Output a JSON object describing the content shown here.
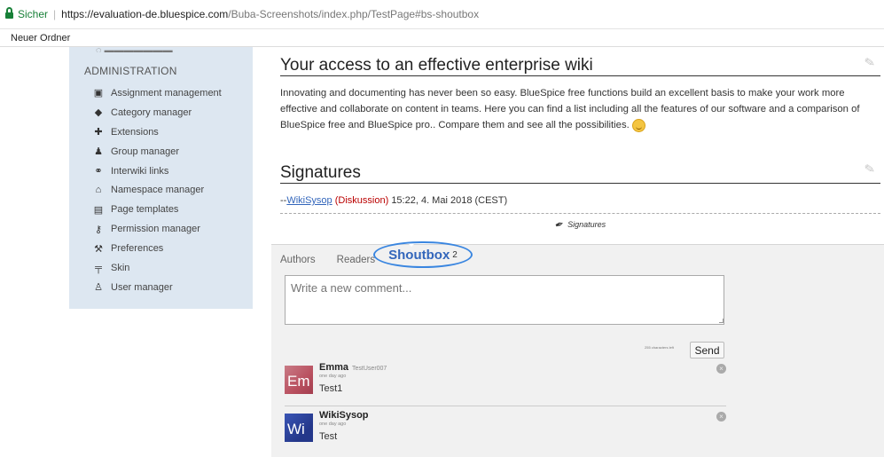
{
  "browser": {
    "secure_label": "Sicher",
    "url_host": "https://evaluation-de.bluespice.com",
    "url_rest": "/Buba-Screenshots/index.php/TestPage#bs-shoutbox",
    "bookmark": "Neuer Ordner"
  },
  "sidebar": {
    "heading": "ADMINISTRATION",
    "items": [
      {
        "label": "Assignment management",
        "icon": "assignment-icon",
        "glyph": "▣"
      },
      {
        "label": "Category manager",
        "icon": "tag-icon",
        "glyph": "◆"
      },
      {
        "label": "Extensions",
        "icon": "puzzle-icon",
        "glyph": "✚"
      },
      {
        "label": "Group manager",
        "icon": "group-icon",
        "glyph": "♟"
      },
      {
        "label": "Interwiki links",
        "icon": "link-icon",
        "glyph": "⚭"
      },
      {
        "label": "Namespace manager",
        "icon": "namespace-icon",
        "glyph": "⌂"
      },
      {
        "label": "Page templates",
        "icon": "clipboard-icon",
        "glyph": "▤"
      },
      {
        "label": "Permission manager",
        "icon": "key-icon",
        "glyph": "⚷"
      },
      {
        "label": "Preferences",
        "icon": "wrench-icon",
        "glyph": "⚒"
      },
      {
        "label": "Skin",
        "icon": "paint-roller-icon",
        "glyph": "╤"
      },
      {
        "label": "User manager",
        "icon": "users-icon",
        "glyph": "♙"
      }
    ]
  },
  "main": {
    "section1_title": "Your access to an effective enterprise wiki",
    "section1_text": "Innovating and documenting has never been so easy. BlueSpice free functions build an excellent basis to make your work more effective and collaborate on content in teams. Here you can find a list including all the features of our software and a comparison of BlueSpice free and BlueSpice pro.. Compare them and see all the possibilities.",
    "section2_title": "Signatures",
    "signature": {
      "prefix": "--",
      "user": "WikiSysop",
      "talk": "(Diskussion)",
      "timestamp": "15:22, 4. Mai 2018 (CEST)"
    },
    "signatures_tag": "Signatures"
  },
  "panel": {
    "tabs": [
      "Authors",
      "Readers"
    ],
    "active_tab": "Shoutbox",
    "active_count": "2",
    "comment_placeholder": "Write a new comment...",
    "chars_left": "255 characters left",
    "send_label": "Send",
    "entries": [
      {
        "avatar": "Em",
        "avatar_color": "#b9505f",
        "name": "Emma",
        "user_id": "TestUser007",
        "time": "one day ago",
        "text": "Test1"
      },
      {
        "avatar": "Wi",
        "avatar_color": "#24378a",
        "name": "WikiSysop",
        "user_id": "",
        "time": "one day ago",
        "text": "Test"
      }
    ]
  }
}
